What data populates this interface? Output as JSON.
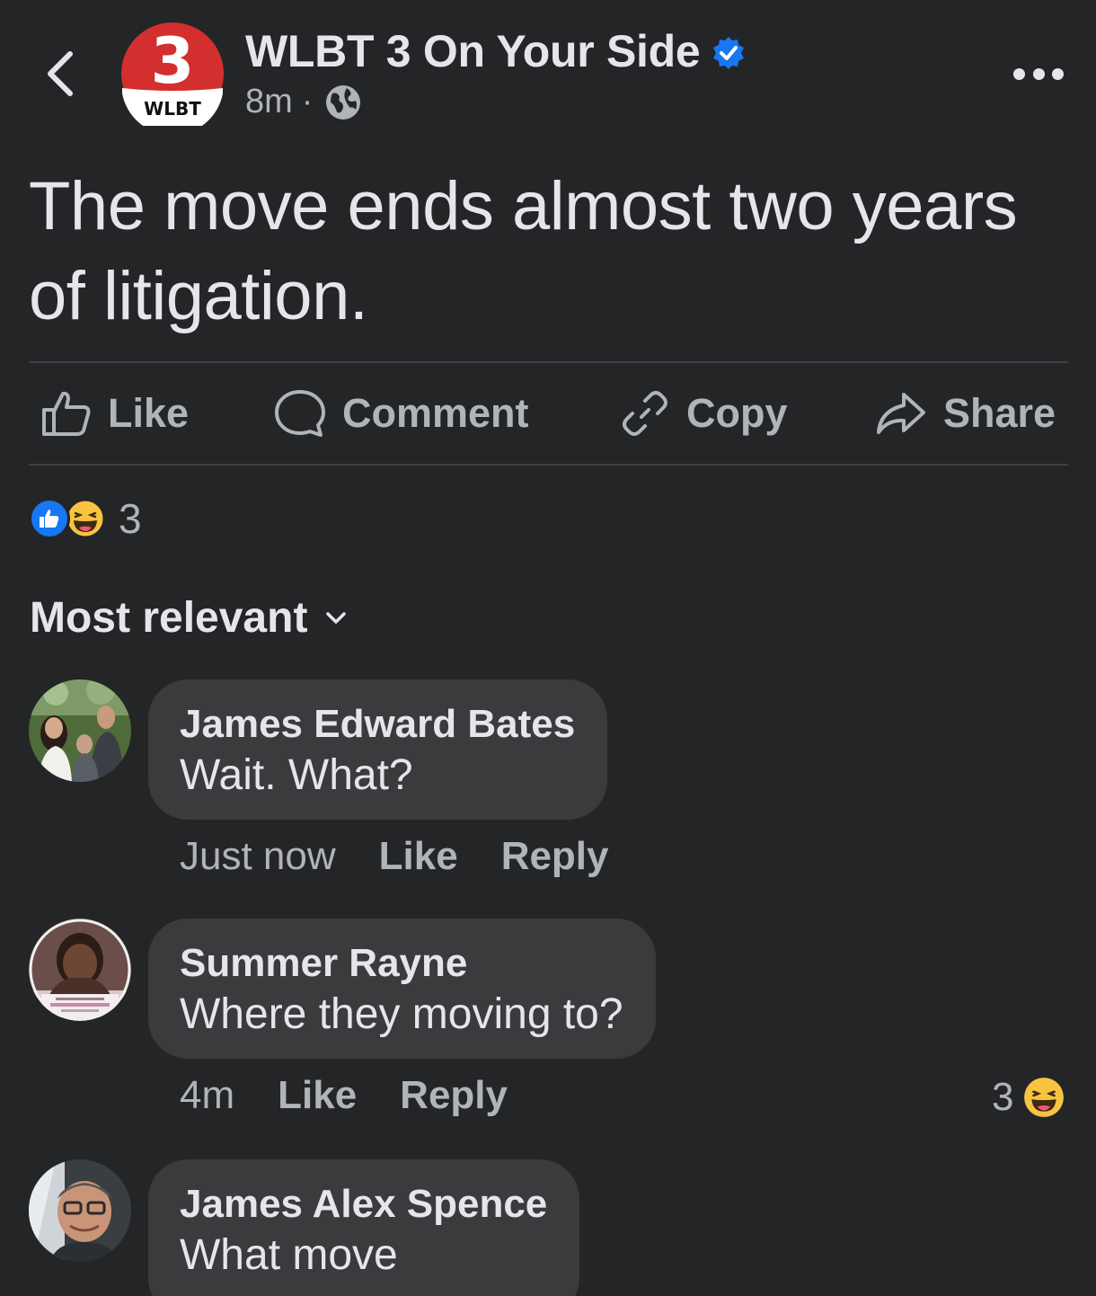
{
  "header": {
    "page_name": "WLBT 3 On Your Side",
    "time": "8m",
    "separator": "·",
    "logo_number": "3",
    "logo_text": "WLBT"
  },
  "post": {
    "text": "The move ends almost two years of litigation."
  },
  "actions": {
    "like": "Like",
    "comment": "Comment",
    "copy": "Copy",
    "share": "Share"
  },
  "reactions": {
    "count": "3"
  },
  "sort": {
    "label": "Most relevant"
  },
  "comments": [
    {
      "name": "James Edward Bates",
      "text": "Wait. What?",
      "time": "Just now",
      "like": "Like",
      "reply": "Reply"
    },
    {
      "name": "Summer Rayne",
      "text": "Where they moving to?",
      "time": "4m",
      "like": "Like",
      "reply": "Reply",
      "reaction_count": "3"
    },
    {
      "name": "James Alex Spence",
      "text": "What move"
    }
  ],
  "colors": {
    "background": "#242526",
    "bubble": "#3a3b3c",
    "accent_blue": "#1877f2",
    "logo_red": "#d32f2f"
  }
}
